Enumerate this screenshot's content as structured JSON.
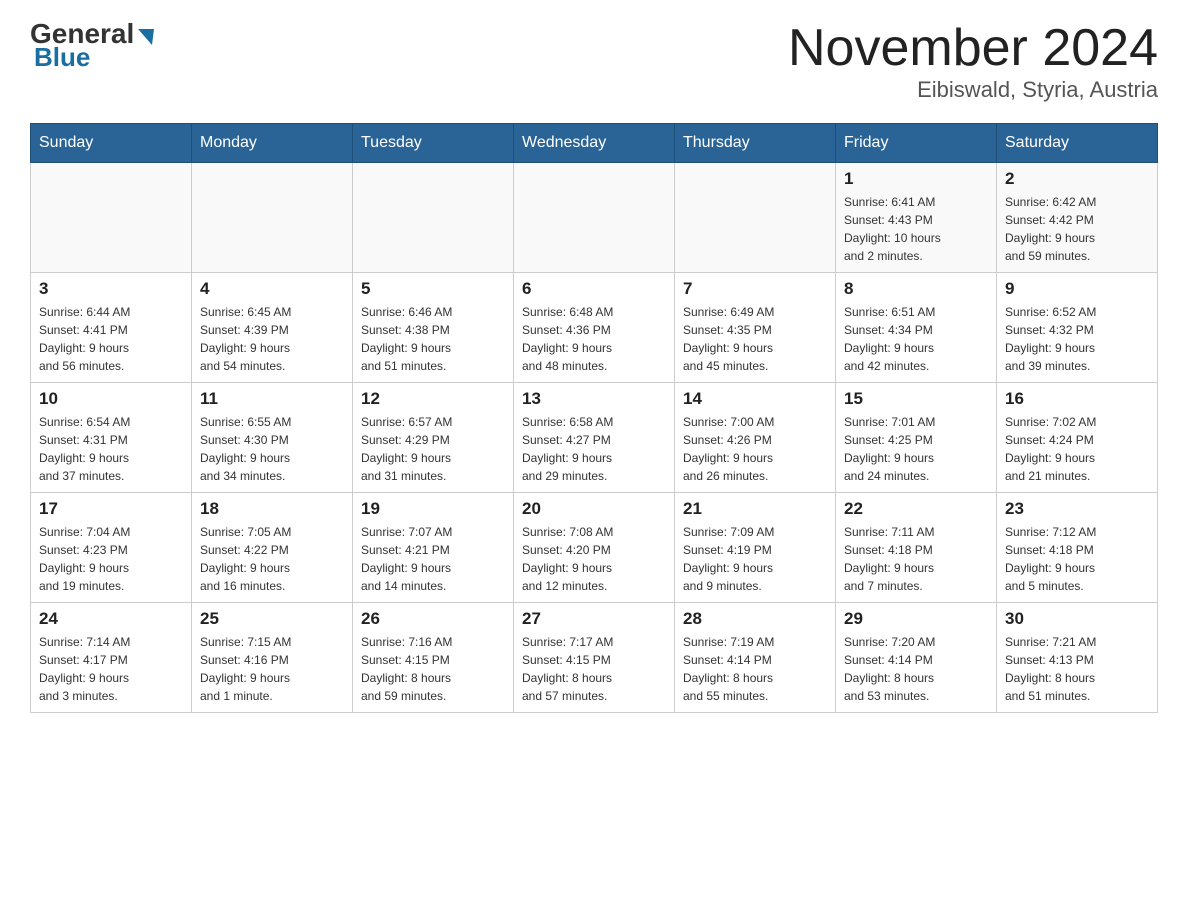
{
  "header": {
    "logo_general": "General",
    "logo_blue": "Blue",
    "month_title": "November 2024",
    "location": "Eibiswald, Styria, Austria"
  },
  "days_of_week": [
    "Sunday",
    "Monday",
    "Tuesday",
    "Wednesday",
    "Thursday",
    "Friday",
    "Saturday"
  ],
  "weeks": [
    [
      {
        "day": "",
        "info": ""
      },
      {
        "day": "",
        "info": ""
      },
      {
        "day": "",
        "info": ""
      },
      {
        "day": "",
        "info": ""
      },
      {
        "day": "",
        "info": ""
      },
      {
        "day": "1",
        "info": "Sunrise: 6:41 AM\nSunset: 4:43 PM\nDaylight: 10 hours\nand 2 minutes."
      },
      {
        "day": "2",
        "info": "Sunrise: 6:42 AM\nSunset: 4:42 PM\nDaylight: 9 hours\nand 59 minutes."
      }
    ],
    [
      {
        "day": "3",
        "info": "Sunrise: 6:44 AM\nSunset: 4:41 PM\nDaylight: 9 hours\nand 56 minutes."
      },
      {
        "day": "4",
        "info": "Sunrise: 6:45 AM\nSunset: 4:39 PM\nDaylight: 9 hours\nand 54 minutes."
      },
      {
        "day": "5",
        "info": "Sunrise: 6:46 AM\nSunset: 4:38 PM\nDaylight: 9 hours\nand 51 minutes."
      },
      {
        "day": "6",
        "info": "Sunrise: 6:48 AM\nSunset: 4:36 PM\nDaylight: 9 hours\nand 48 minutes."
      },
      {
        "day": "7",
        "info": "Sunrise: 6:49 AM\nSunset: 4:35 PM\nDaylight: 9 hours\nand 45 minutes."
      },
      {
        "day": "8",
        "info": "Sunrise: 6:51 AM\nSunset: 4:34 PM\nDaylight: 9 hours\nand 42 minutes."
      },
      {
        "day": "9",
        "info": "Sunrise: 6:52 AM\nSunset: 4:32 PM\nDaylight: 9 hours\nand 39 minutes."
      }
    ],
    [
      {
        "day": "10",
        "info": "Sunrise: 6:54 AM\nSunset: 4:31 PM\nDaylight: 9 hours\nand 37 minutes."
      },
      {
        "day": "11",
        "info": "Sunrise: 6:55 AM\nSunset: 4:30 PM\nDaylight: 9 hours\nand 34 minutes."
      },
      {
        "day": "12",
        "info": "Sunrise: 6:57 AM\nSunset: 4:29 PM\nDaylight: 9 hours\nand 31 minutes."
      },
      {
        "day": "13",
        "info": "Sunrise: 6:58 AM\nSunset: 4:27 PM\nDaylight: 9 hours\nand 29 minutes."
      },
      {
        "day": "14",
        "info": "Sunrise: 7:00 AM\nSunset: 4:26 PM\nDaylight: 9 hours\nand 26 minutes."
      },
      {
        "day": "15",
        "info": "Sunrise: 7:01 AM\nSunset: 4:25 PM\nDaylight: 9 hours\nand 24 minutes."
      },
      {
        "day": "16",
        "info": "Sunrise: 7:02 AM\nSunset: 4:24 PM\nDaylight: 9 hours\nand 21 minutes."
      }
    ],
    [
      {
        "day": "17",
        "info": "Sunrise: 7:04 AM\nSunset: 4:23 PM\nDaylight: 9 hours\nand 19 minutes."
      },
      {
        "day": "18",
        "info": "Sunrise: 7:05 AM\nSunset: 4:22 PM\nDaylight: 9 hours\nand 16 minutes."
      },
      {
        "day": "19",
        "info": "Sunrise: 7:07 AM\nSunset: 4:21 PM\nDaylight: 9 hours\nand 14 minutes."
      },
      {
        "day": "20",
        "info": "Sunrise: 7:08 AM\nSunset: 4:20 PM\nDaylight: 9 hours\nand 12 minutes."
      },
      {
        "day": "21",
        "info": "Sunrise: 7:09 AM\nSunset: 4:19 PM\nDaylight: 9 hours\nand 9 minutes."
      },
      {
        "day": "22",
        "info": "Sunrise: 7:11 AM\nSunset: 4:18 PM\nDaylight: 9 hours\nand 7 minutes."
      },
      {
        "day": "23",
        "info": "Sunrise: 7:12 AM\nSunset: 4:18 PM\nDaylight: 9 hours\nand 5 minutes."
      }
    ],
    [
      {
        "day": "24",
        "info": "Sunrise: 7:14 AM\nSunset: 4:17 PM\nDaylight: 9 hours\nand 3 minutes."
      },
      {
        "day": "25",
        "info": "Sunrise: 7:15 AM\nSunset: 4:16 PM\nDaylight: 9 hours\nand 1 minute."
      },
      {
        "day": "26",
        "info": "Sunrise: 7:16 AM\nSunset: 4:15 PM\nDaylight: 8 hours\nand 59 minutes."
      },
      {
        "day": "27",
        "info": "Sunrise: 7:17 AM\nSunset: 4:15 PM\nDaylight: 8 hours\nand 57 minutes."
      },
      {
        "day": "28",
        "info": "Sunrise: 7:19 AM\nSunset: 4:14 PM\nDaylight: 8 hours\nand 55 minutes."
      },
      {
        "day": "29",
        "info": "Sunrise: 7:20 AM\nSunset: 4:14 PM\nDaylight: 8 hours\nand 53 minutes."
      },
      {
        "day": "30",
        "info": "Sunrise: 7:21 AM\nSunset: 4:13 PM\nDaylight: 8 hours\nand 51 minutes."
      }
    ]
  ]
}
